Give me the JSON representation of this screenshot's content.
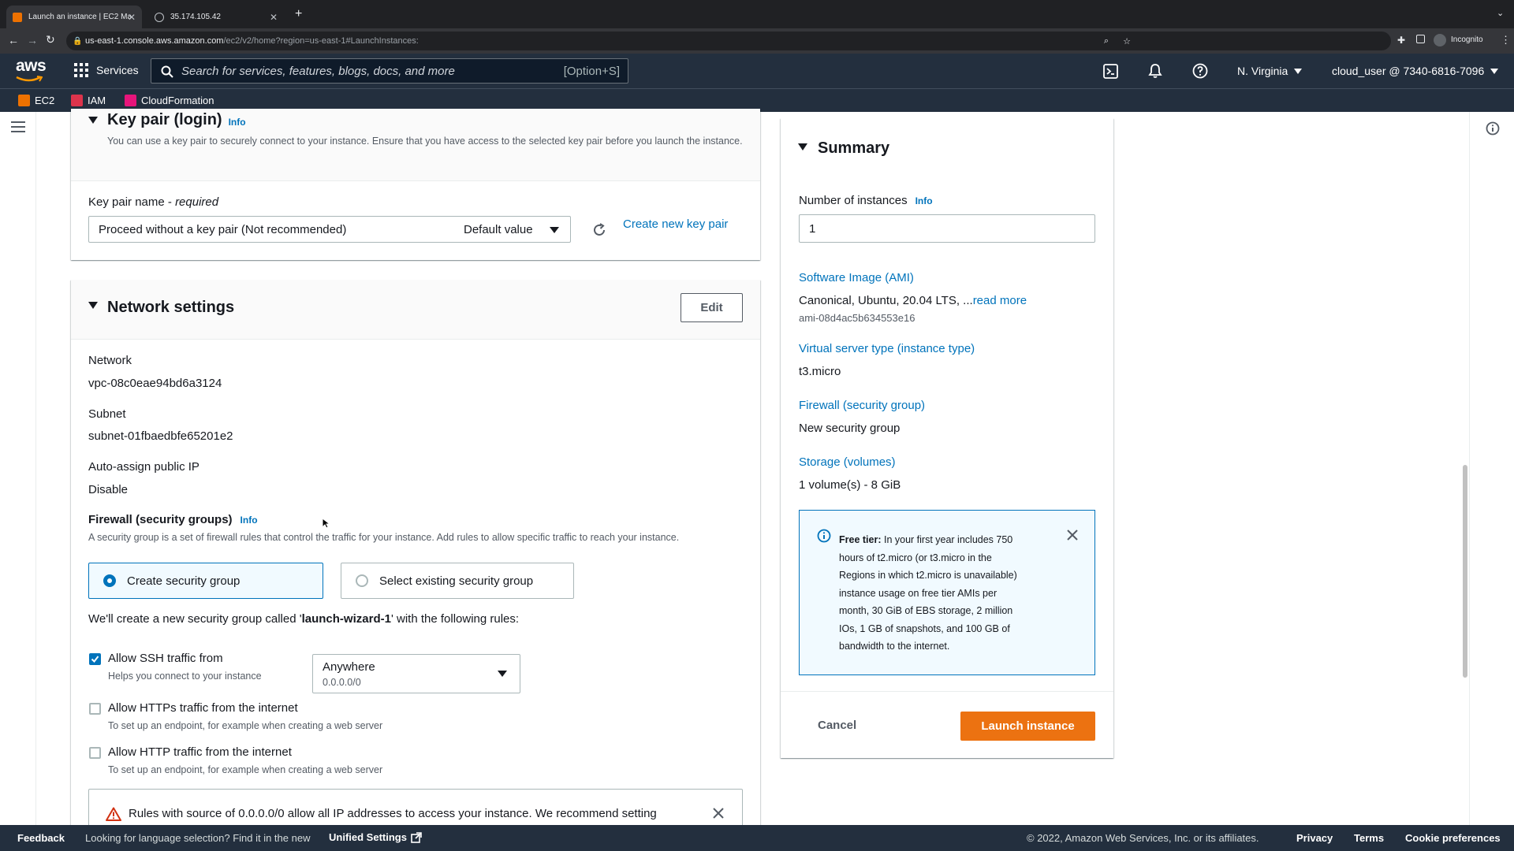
{
  "browser": {
    "tabs": [
      {
        "title": "Launch an instance | EC2 Man",
        "active": true
      },
      {
        "title": "35.174.105.42",
        "active": false
      }
    ],
    "url_domain": "us-east-1.console.aws.amazon.com",
    "url_path": "/ec2/v2/home?region=us-east-1#LaunchInstances:",
    "profile_label": "Incognito"
  },
  "aws_nav": {
    "logo": "aws",
    "services_label": "Services",
    "search_placeholder": "Search for services, features, blogs, docs, and more",
    "search_shortcut": "[Option+S]",
    "region": "N. Virginia",
    "account": "cloud_user @ 7340-6816-7096"
  },
  "favorites": [
    {
      "label": "EC2",
      "color": "#ed7100"
    },
    {
      "label": "IAM",
      "color": "#dd344c"
    },
    {
      "label": "CloudFormation",
      "color": "#e7157b"
    }
  ],
  "keypair": {
    "title": "Key pair (login)",
    "info": "Info",
    "description": "You can use a key pair to securely connect to your instance. Ensure that you have access to the selected key pair before you launch the instance.",
    "field_label": "Key pair name",
    "field_required": "required",
    "select_value": "Proceed without a key pair (Not recommended)",
    "select_tag": "Default value",
    "create_link": "Create new key pair"
  },
  "network": {
    "title": "Network settings",
    "edit": "Edit",
    "network_label": "Network",
    "network_value": "vpc-08c0eae94bd6a3124",
    "subnet_label": "Subnet",
    "subnet_value": "subnet-01fbaedbfe65201e2",
    "public_ip_label": "Auto-assign public IP",
    "public_ip_value": "Disable",
    "firewall_label": "Firewall (security groups)",
    "firewall_info": "Info",
    "firewall_desc": "A security group is a set of firewall rules that control the traffic for your instance. Add rules to allow specific traffic to reach your instance.",
    "option_create": "Create security group",
    "option_existing": "Select existing security group",
    "create_text_pre": "We'll create a new security group called '",
    "create_text_name": "launch-wizard-1",
    "create_text_post": "' with the following rules:",
    "rules": [
      {
        "label": "Allow SSH traffic from",
        "help": "Helps you connect to your instance",
        "checked": true
      },
      {
        "label": "Allow HTTPs traffic from the internet",
        "help": "To set up an endpoint, for example when creating a web server",
        "checked": false
      },
      {
        "label": "Allow HTTP traffic from the internet",
        "help": "To set up an endpoint, for example when creating a web server",
        "checked": false
      }
    ],
    "ssh_source": "Anywhere",
    "ssh_cidr": "0.0.0.0/0",
    "warning": "Rules with source of 0.0.0.0/0 allow all IP addresses to access your instance. We recommend setting"
  },
  "summary": {
    "title": "Summary",
    "instances_label": "Number of instances",
    "instances_info": "Info",
    "instances_value": "1",
    "ami_label": "Software Image (AMI)",
    "ami_value": "Canonical, Ubuntu, 20.04 LTS, ...",
    "ami_read_more": "read more",
    "ami_id": "ami-08d4ac5b634553e16",
    "type_label": "Virtual server type (instance type)",
    "type_value": "t3.micro",
    "fw_label": "Firewall (security group)",
    "fw_value": "New security group",
    "storage_label": "Storage (volumes)",
    "storage_value": "1 volume(s) - 8 GiB",
    "free_tier_title": "Free tier:",
    "free_tier_text": " In your first year includes 750 hours of t2.micro (or t3.micro in the Regions in which t2.micro is unavailable) instance usage on free tier AMIs per month, 30 GiB of EBS storage, 2 million IOs, 1 GB of snapshots, and 100 GB of bandwidth to the internet.",
    "cancel": "Cancel",
    "launch": "Launch instance"
  },
  "footer": {
    "feedback": "Feedback",
    "language_text": "Looking for language selection? Find it in the new",
    "unified_settings": "Unified Settings",
    "copyright": "© 2022, Amazon Web Services, Inc. or its affiliates.",
    "privacy": "Privacy",
    "terms": "Terms",
    "cookies": "Cookie preferences"
  },
  "colors": {
    "aws_nav": "#232f3e",
    "link": "#0073bb",
    "primary_button": "#ec7211",
    "info_box_bg": "#f1faff"
  }
}
